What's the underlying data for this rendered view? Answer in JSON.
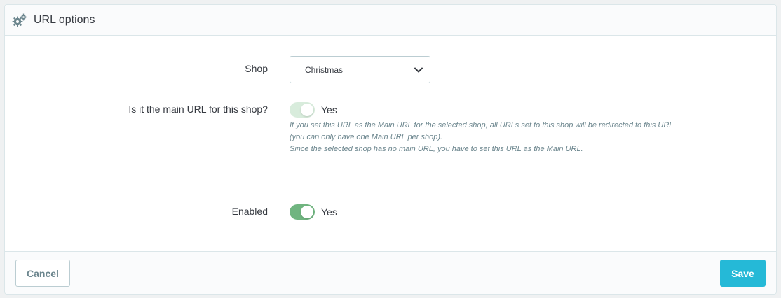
{
  "panel": {
    "title": "URL options",
    "icon": "cogs-icon"
  },
  "form": {
    "shop": {
      "label": "Shop",
      "value": "Christmas"
    },
    "main_url": {
      "label": "Is it the main URL for this shop?",
      "value": "Yes",
      "enabled": false,
      "help_lines": [
        "If you set this URL as the Main URL for the selected shop, all URLs set to this shop will be redirected to this URL",
        "(you can only have one Main URL per shop).",
        "Since the selected shop has no main URL, you have to set this URL as the Main URL."
      ]
    },
    "enabled": {
      "label": "Enabled",
      "value": "Yes",
      "enabled": true
    }
  },
  "footer": {
    "cancel_label": "Cancel",
    "save_label": "Save"
  },
  "colors": {
    "switch_on": "#70b580",
    "switch_disabled": "#d8ecdc",
    "primary": "#25b9d7",
    "help_text": "#6c868e"
  }
}
